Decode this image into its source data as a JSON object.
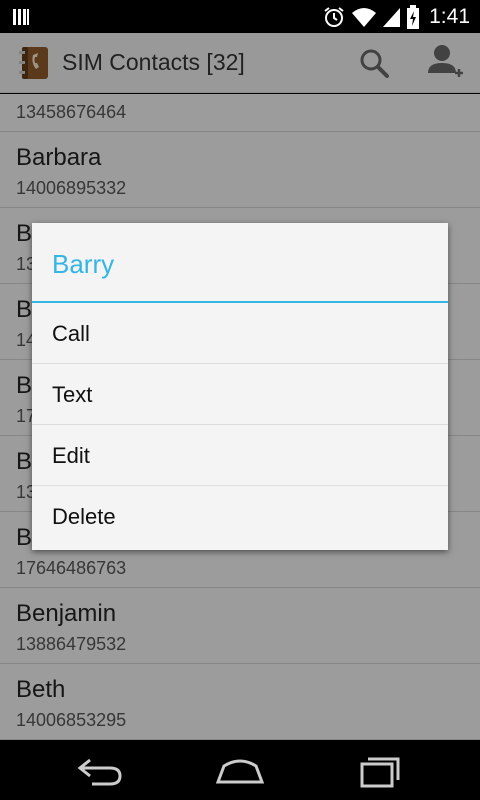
{
  "status_bar": {
    "time": "1:41"
  },
  "app_bar": {
    "title": "SIM Contacts [32]"
  },
  "contacts": [
    {
      "name": "",
      "number": "13458676464"
    },
    {
      "name": "Barbara",
      "number": "14006895332"
    },
    {
      "name": "B",
      "number": "13"
    },
    {
      "name": "B",
      "number": "14"
    },
    {
      "name": "B",
      "number": "17"
    },
    {
      "name": "B",
      "number": "13"
    },
    {
      "name": "B",
      "number": "17646486763"
    },
    {
      "name": "Benjamin",
      "number": "13886479532"
    },
    {
      "name": "Beth",
      "number": "14006853295"
    }
  ],
  "dialog": {
    "title": "Barry",
    "items": [
      "Call",
      "Text",
      "Edit",
      "Delete"
    ],
    "accent_color": "#33b5e5"
  }
}
